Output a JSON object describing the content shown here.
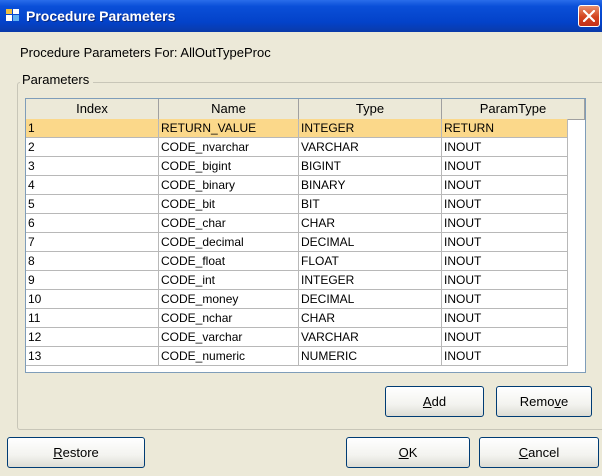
{
  "window": {
    "title": "Procedure Parameters",
    "icon": "app-icon",
    "close_icon": "close-icon"
  },
  "heading": "Procedure Parameters For: AllOutTypeProc",
  "group_label": "Parameters",
  "table": {
    "columns": [
      "Index",
      "Name",
      "Type",
      "ParamType"
    ],
    "rows": [
      [
        "1",
        "RETURN_VALUE",
        "INTEGER",
        "RETURN"
      ],
      [
        "2",
        "CODE_nvarchar",
        "VARCHAR",
        "INOUT"
      ],
      [
        "3",
        "CODE_bigint",
        "BIGINT",
        "INOUT"
      ],
      [
        "4",
        "CODE_binary",
        "BINARY",
        "INOUT"
      ],
      [
        "5",
        "CODE_bit",
        "BIT",
        "INOUT"
      ],
      [
        "6",
        "CODE_char",
        "CHAR",
        "INOUT"
      ],
      [
        "7",
        "CODE_decimal",
        "DECIMAL",
        "INOUT"
      ],
      [
        "8",
        "CODE_float",
        "FLOAT",
        "INOUT"
      ],
      [
        "9",
        "CODE_int",
        "INTEGER",
        "INOUT"
      ],
      [
        "10",
        "CODE_money",
        "DECIMAL",
        "INOUT"
      ],
      [
        "11",
        "CODE_nchar",
        "CHAR",
        "INOUT"
      ],
      [
        "12",
        "CODE_varchar",
        "VARCHAR",
        "INOUT"
      ],
      [
        "13",
        "CODE_numeric",
        "NUMERIC",
        "INOUT"
      ]
    ],
    "selected_row": 0
  },
  "buttons": {
    "add": {
      "label": "Add",
      "mnemonic": "A"
    },
    "remove": {
      "label": "Remove",
      "mnemonic": "v"
    },
    "restore": {
      "label": "Restore",
      "mnemonic": "R"
    },
    "ok": {
      "label": "OK",
      "mnemonic": "O"
    },
    "cancel": {
      "label": "Cancel",
      "mnemonic": "C"
    }
  },
  "colors": {
    "title_bar": "#0a4fd8",
    "selection": "#fbd88a",
    "dialog_bg": "#ece9d8"
  }
}
